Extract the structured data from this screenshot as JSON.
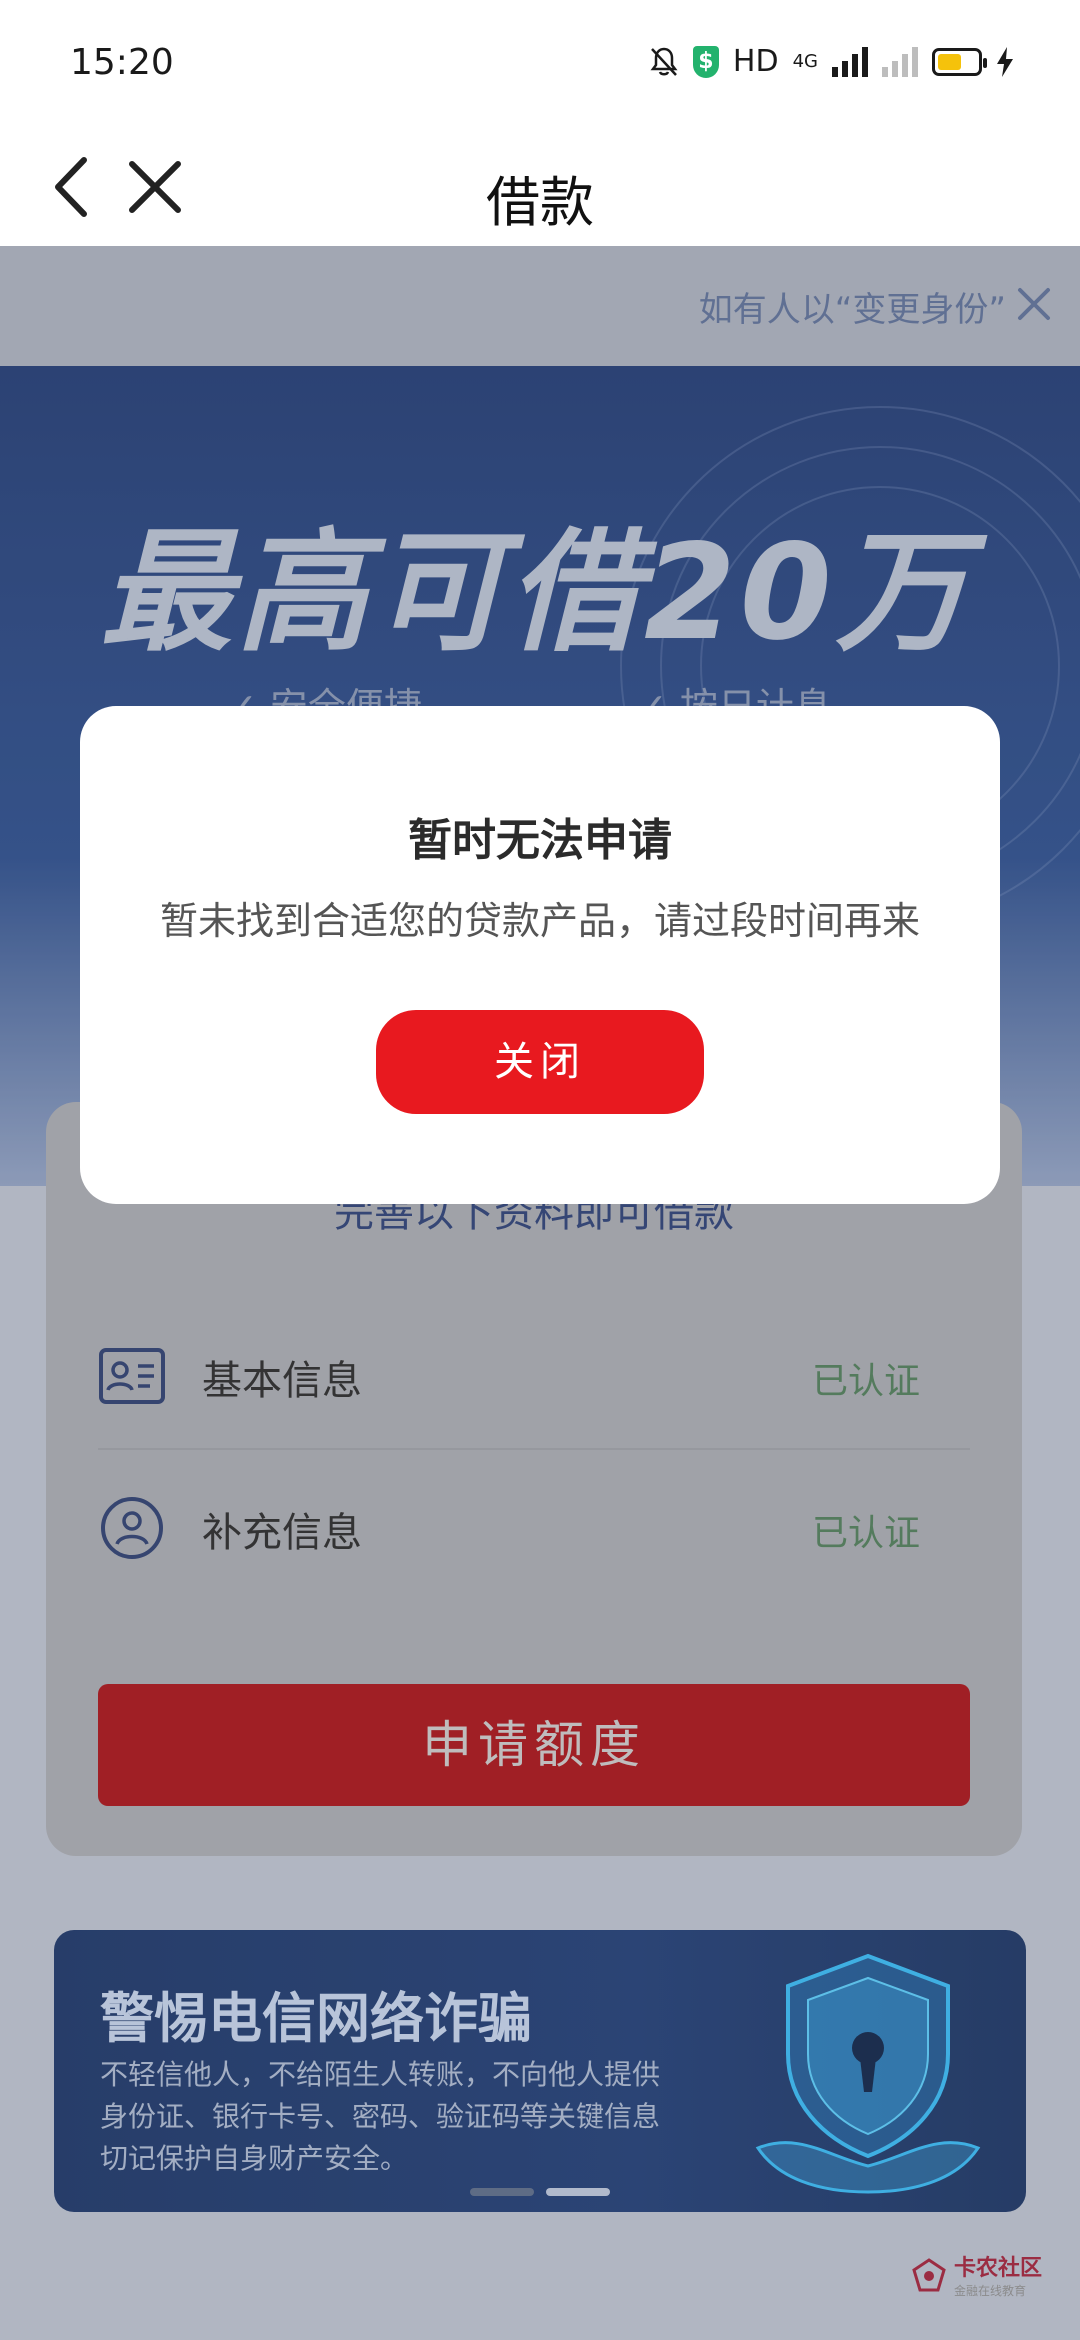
{
  "status_bar": {
    "time": "15:20",
    "network_label": "HD",
    "signal_label": "4G",
    "icons": [
      "mute-bell-icon",
      "shield-icon",
      "signal-icon",
      "signal-empty-icon",
      "battery-icon",
      "charging-icon"
    ]
  },
  "nav": {
    "title": "借款",
    "back_icon": "chevron-left-icon",
    "close_icon": "close-icon"
  },
  "notice": {
    "text": "如有人以“变更身份”",
    "close_icon": "close-icon"
  },
  "hero": {
    "title": "最高可借20万",
    "features": [
      "✓ 安全便捷",
      "✓ 按日计息"
    ]
  },
  "card": {
    "heading": "完善以下资料即可借款",
    "rows": [
      {
        "label": "基本信息",
        "status": "已认证",
        "icon": "id-card-icon"
      },
      {
        "label": "补充信息",
        "status": "已认证",
        "icon": "user-circle-icon"
      }
    ],
    "button_label": "申请额度"
  },
  "banner": {
    "title": "警惕电信网络诈骗",
    "lines": [
      "不轻信他人，不给陌生人转账，不向他人提供",
      "身份证、银行卡号、密码、验证码等关键信息",
      "切记保护自身财产安全。"
    ],
    "art_icon": "shield-lock-hand-icon",
    "active_slide": 2,
    "slide_count": 2
  },
  "watermark": {
    "name": "卡农社区",
    "sub": "金融在线教育"
  },
  "modal": {
    "title": "暂时无法申请",
    "message": "暂未找到合适您的贷款产品，请过段时间再来",
    "button_label": "关闭"
  },
  "colors": {
    "primary_red": "#e8191f",
    "verified_green": "#4f7b58",
    "hero_blue": "#223b72"
  }
}
